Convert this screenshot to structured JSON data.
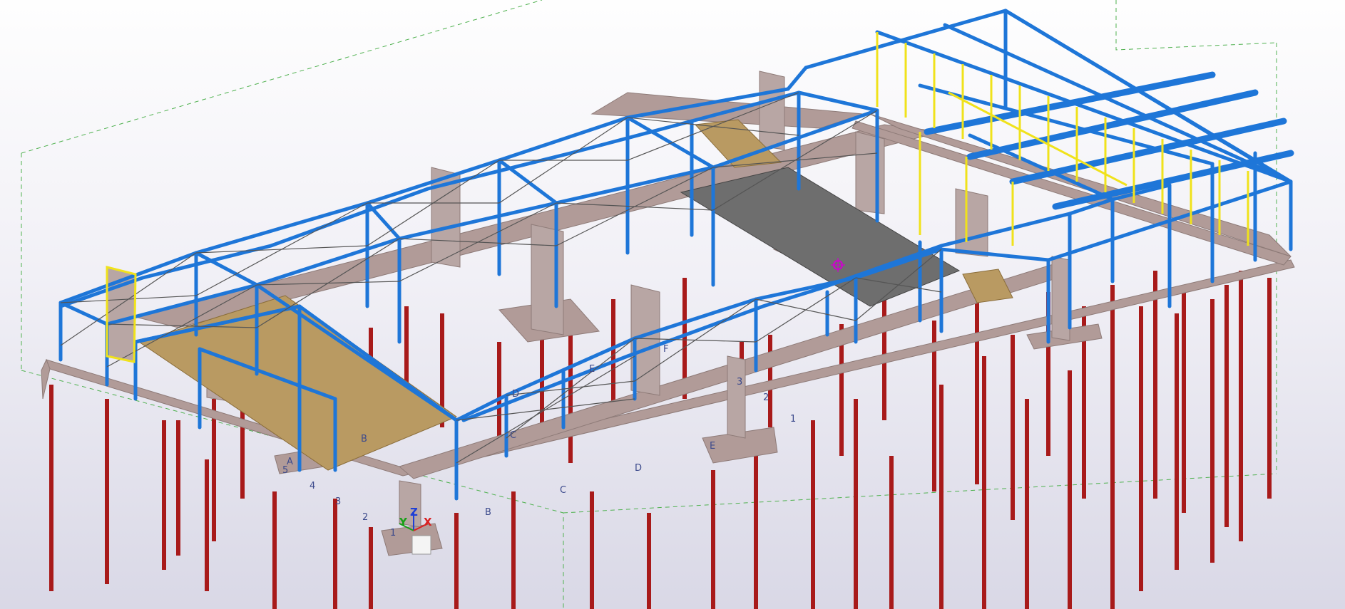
{
  "colors": {
    "steel": "#1e76d8",
    "secondary_steel": "#f0e21b",
    "pile": "#a81a1a",
    "concrete": "#b19b98",
    "concrete_dark": "#8e7b78",
    "slab": "#6e6e6e",
    "deck": "#b99a62",
    "bracing": "#555555",
    "work_area": "#4fb14f",
    "grid_line": "#3c4a8c",
    "axis_x": "#d92020",
    "axis_y": "#18a018",
    "axis_z": "#1f3fd6"
  },
  "gridlines": {
    "letters": [
      "A",
      "B",
      "C",
      "D",
      "E",
      "F"
    ],
    "numbers": [
      "1",
      "2",
      "3",
      "4",
      "5"
    ]
  },
  "axes": {
    "x": "X",
    "y": "Y",
    "z": "Z"
  },
  "icons": {
    "view_center": "view-rotation-center-icon"
  }
}
